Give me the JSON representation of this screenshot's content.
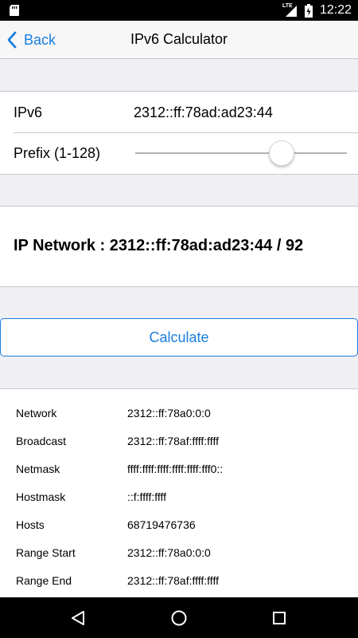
{
  "status_bar": {
    "network_type": "LTE",
    "time": "12:22"
  },
  "nav": {
    "back_label": "Back",
    "title": "IPv6 Calculator"
  },
  "form": {
    "ipv6_label": "IPv6",
    "ipv6_value": "2312::ff:78ad:ad23:44",
    "prefix_label": "Prefix (1-128)",
    "prefix_value": 92,
    "prefix_min": 1,
    "prefix_max": 128
  },
  "network_text": "IP Network : 2312::ff:78ad:ad23:44 / 92",
  "calculate_label": "Calculate",
  "results": [
    {
      "key": "Network",
      "value": "2312::ff:78a0:0:0"
    },
    {
      "key": "Broadcast",
      "value": "2312::ff:78af:ffff:ffff"
    },
    {
      "key": "Netmask",
      "value": "ffff:ffff:ffff:ffff:ffff:fff0::"
    },
    {
      "key": "Hostmask",
      "value": "::f:ffff:ffff"
    },
    {
      "key": "Hosts",
      "value": "68719476736"
    },
    {
      "key": "Range Start",
      "value": "2312::ff:78a0:0:0"
    },
    {
      "key": "Range End",
      "value": "2312::ff:78af:ffff:ffff"
    }
  ],
  "colors": {
    "accent": "#1a7de0",
    "background": "#efeff4",
    "separator": "#c8c7cc"
  }
}
